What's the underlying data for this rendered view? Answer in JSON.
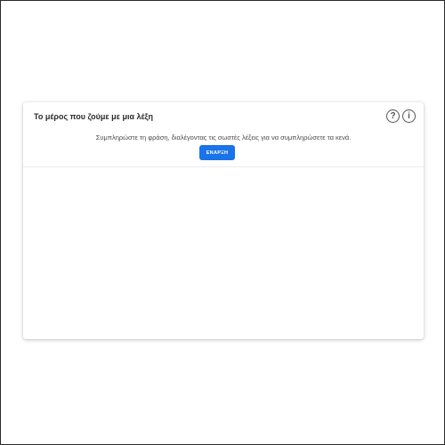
{
  "activity": {
    "title": "Το μέρος που ζούμε με μια λέξη",
    "instructions": "Συμπληρώστε τη φράση, διαλέγοντας τις σωστές λέξεις για να συμπληρώσετε τα κενά.",
    "start_label": "ΕΝΑΡΞΗ",
    "help_icon": "?",
    "info_icon": "i"
  },
  "colors": {
    "accent": "#1a73e8",
    "title_text": "#2b2b2b",
    "icon": "#555555"
  }
}
